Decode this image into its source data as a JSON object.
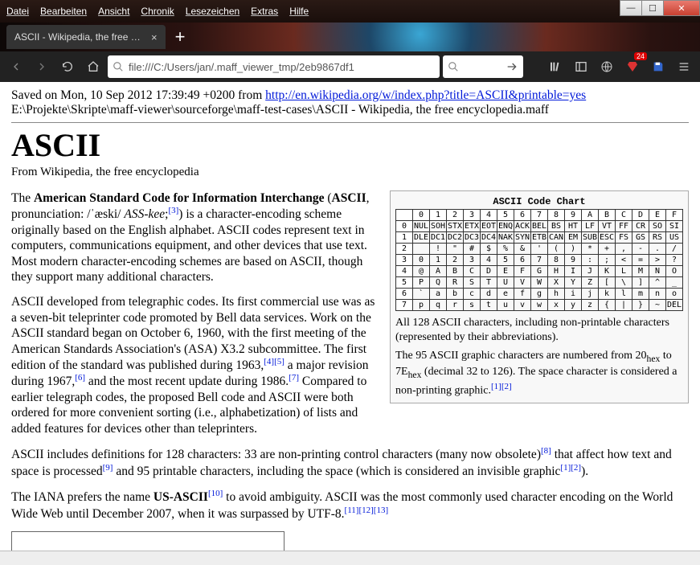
{
  "menu": [
    "Datei",
    "Bearbeiten",
    "Ansicht",
    "Chronik",
    "Lesezeichen",
    "Extras",
    "Hilfe"
  ],
  "tab": {
    "title": "ASCII - Wikipedia, the free encyclop…"
  },
  "url": "file:///C:/Users/jan/.maff_viewer_tmp/2eb9867df1",
  "badge_count": "24",
  "saved": {
    "prefix": "Saved on Mon, 10 Sep 2012 17:39:49 +0200 from ",
    "link": "http://en.wikipedia.org/w/index.php?title=ASCII&printable=yes",
    "path": "E:\\Projekte\\Skripte\\maff-viewer\\sourceforge\\maff-test-cases\\ASCII - Wikipedia, the free encyclopedia.maff"
  },
  "h1": "ASCII",
  "subtitle": "From Wikipedia, the free encyclopedia",
  "p1a": "The ",
  "p1b": "American Standard Code for Information Interchange",
  "p1c": " (",
  "p1d": "ASCII",
  "p1e": ", pronunciation: /ˈæski/ ",
  "p1f": "ASS-kee",
  "p1g": ";",
  "p1h": ") is a character-encoding scheme originally based on the English alphabet. ASCII codes represent text in computers, communications equipment, and other devices that use text. Most modern character-encoding schemes are based on ASCII, though they support many additional characters.",
  "p2a": "ASCII developed from telegraphic codes. Its first commercial use was as a seven-bit teleprinter code promoted by Bell data services. Work on the ASCII standard began on October 6, 1960, with the first meeting of the American Standards Association's (ASA) X3.2 subcommittee. The first edition of the standard was published during 1963,",
  "p2b": " a major revision during 1967,",
  "p2c": " and the most recent update during 1986.",
  "p2d": " Compared to earlier telegraph codes, the proposed Bell code and ASCII were both ordered for more convenient sorting (i.e., alphabetization) of lists and added features for devices other than teleprinters.",
  "p3a": "ASCII includes definitions for 128 characters: 33 are non-printing control characters (many now obsolete)",
  "p3b": " that affect how text and space is processed",
  "p3c": " and 95 printable characters, including the space (which is considered an invisible graphic",
  "p3d": ").",
  "p4a": "The IANA prefers the name ",
  "p4b": "US-ASCII",
  "p4c": " to avoid ambiguity. ASCII was the most commonly used character encoding on the World Wide Web until December 2007, when it was surpassed by UTF-8.",
  "refs": {
    "r3": "[3]",
    "r4": "[4]",
    "r5": "[5]",
    "r6": "[6]",
    "r7": "[7]",
    "r8": "[8]",
    "r9": "[9]",
    "r1": "[1]",
    "r2": "[2]",
    "r10": "[10]",
    "r11": "[11]",
    "r12": "[12]",
    "r13": "[13]"
  },
  "figure": {
    "title": "ASCII Code Chart",
    "cap1": "All 128 ASCII characters, including non-printable characters (represented by their abbreviations).",
    "cap2a": "The 95 ASCII graphic characters are numbered from 20",
    "cap2b": " to 7E",
    "cap2c": " (decimal 32 to 126). The space character is considered a non-printing graphic.",
    "hex": "hex"
  },
  "chart_data": {
    "type": "table",
    "title": "ASCII Code Chart",
    "columns": [
      "0",
      "1",
      "2",
      "3",
      "4",
      "5",
      "6",
      "7",
      "8",
      "9",
      "A",
      "B",
      "C",
      "D",
      "E",
      "F"
    ],
    "rows": [
      [
        "NUL",
        "SOH",
        "STX",
        "ETX",
        "EOT",
        "ENQ",
        "ACK",
        "BEL",
        "BS",
        "HT",
        "LF",
        "VT",
        "FF",
        "CR",
        "SO",
        "SI"
      ],
      [
        "DLE",
        "DC1",
        "DC2",
        "DC3",
        "DC4",
        "NAK",
        "SYN",
        "ETB",
        "CAN",
        "EM",
        "SUB",
        "ESC",
        "FS",
        "GS",
        "RS",
        "US"
      ],
      [
        " ",
        "!",
        "\"",
        "#",
        "$",
        "%",
        "&",
        "'",
        "(",
        ")",
        "*",
        "+",
        ",",
        "-",
        ".",
        "/"
      ],
      [
        "0",
        "1",
        "2",
        "3",
        "4",
        "5",
        "6",
        "7",
        "8",
        "9",
        ":",
        ";",
        "<",
        "=",
        ">",
        "?"
      ],
      [
        "@",
        "A",
        "B",
        "C",
        "D",
        "E",
        "F",
        "G",
        "H",
        "I",
        "J",
        "K",
        "L",
        "M",
        "N",
        "O"
      ],
      [
        "P",
        "Q",
        "R",
        "S",
        "T",
        "U",
        "V",
        "W",
        "X",
        "Y",
        "Z",
        "[",
        "\\",
        "]",
        "^",
        "_"
      ],
      [
        "`",
        "a",
        "b",
        "c",
        "d",
        "e",
        "f",
        "g",
        "h",
        "i",
        "j",
        "k",
        "l",
        "m",
        "n",
        "o"
      ],
      [
        "p",
        "q",
        "r",
        "s",
        "t",
        "u",
        "v",
        "w",
        "x",
        "y",
        "z",
        "{",
        "|",
        "}",
        "~",
        "DEL"
      ]
    ],
    "row_labels": [
      "0",
      "1",
      "2",
      "3",
      "4",
      "5",
      "6",
      "7"
    ]
  }
}
